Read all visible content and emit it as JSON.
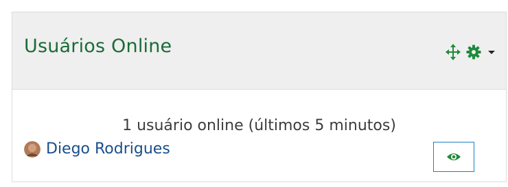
{
  "block": {
    "title": "Usuários Online",
    "controls": {
      "move_icon": "move-arrows-icon",
      "settings_icon": "gear-icon",
      "menu_icon": "caret-down-icon"
    }
  },
  "online_users": {
    "summary": "1 usuário online (últimos 5 minutos)",
    "users": [
      {
        "name": "Diego Rodrigues",
        "avatar_icon": "user-avatar",
        "visibility_icon": "eye-icon"
      }
    ]
  },
  "colors": {
    "title_green": "#1b6b38",
    "icon_green": "#1f8a3c",
    "link_blue": "#1a4e8a",
    "focus_blue": "#1e7fc4",
    "header_bg": "#efefef"
  }
}
